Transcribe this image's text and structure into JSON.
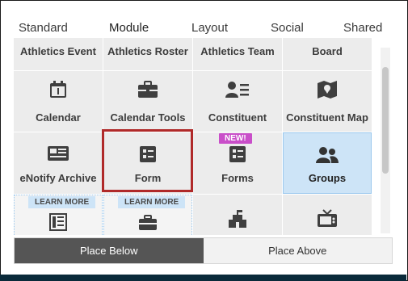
{
  "tabs": [
    {
      "label": "Standard"
    },
    {
      "label": "Module"
    },
    {
      "label": "Layout"
    },
    {
      "label": "Social"
    },
    {
      "label": "Shared"
    }
  ],
  "active_tab": "Module",
  "grid": {
    "row1": [
      "Athletics Event",
      "Athletics Roster",
      "Athletics Team",
      "Board"
    ],
    "row2": [
      "Calendar",
      "Calendar Tools",
      "Constituent",
      "Constituent Map"
    ],
    "row3": [
      "eNotify Archive",
      "Form",
      "Forms",
      "Groups"
    ],
    "badges": {
      "new": "NEW!",
      "learn_more": "LEARN MORE"
    }
  },
  "actions": {
    "place_below": "Place Below",
    "place_above": "Place Above"
  },
  "colors": {
    "selected": "#cde4f7",
    "highlight": "#b02a2a",
    "new_badge": "#c94ec9",
    "primary_button": "#555555"
  },
  "icons": {
    "calendar": "calendar-icon",
    "calendar_tools": "briefcase-icon",
    "constituent": "user-list-icon",
    "constituent_map": "map-pin-icon",
    "enotify": "newspaper-icon",
    "form": "form-icon",
    "forms": "form-icon",
    "groups": "users-icon",
    "row4_1": "columns-icon",
    "row4_2": "briefcase-icon",
    "row4_3": "building-icon",
    "row4_4": "tv-icon"
  }
}
